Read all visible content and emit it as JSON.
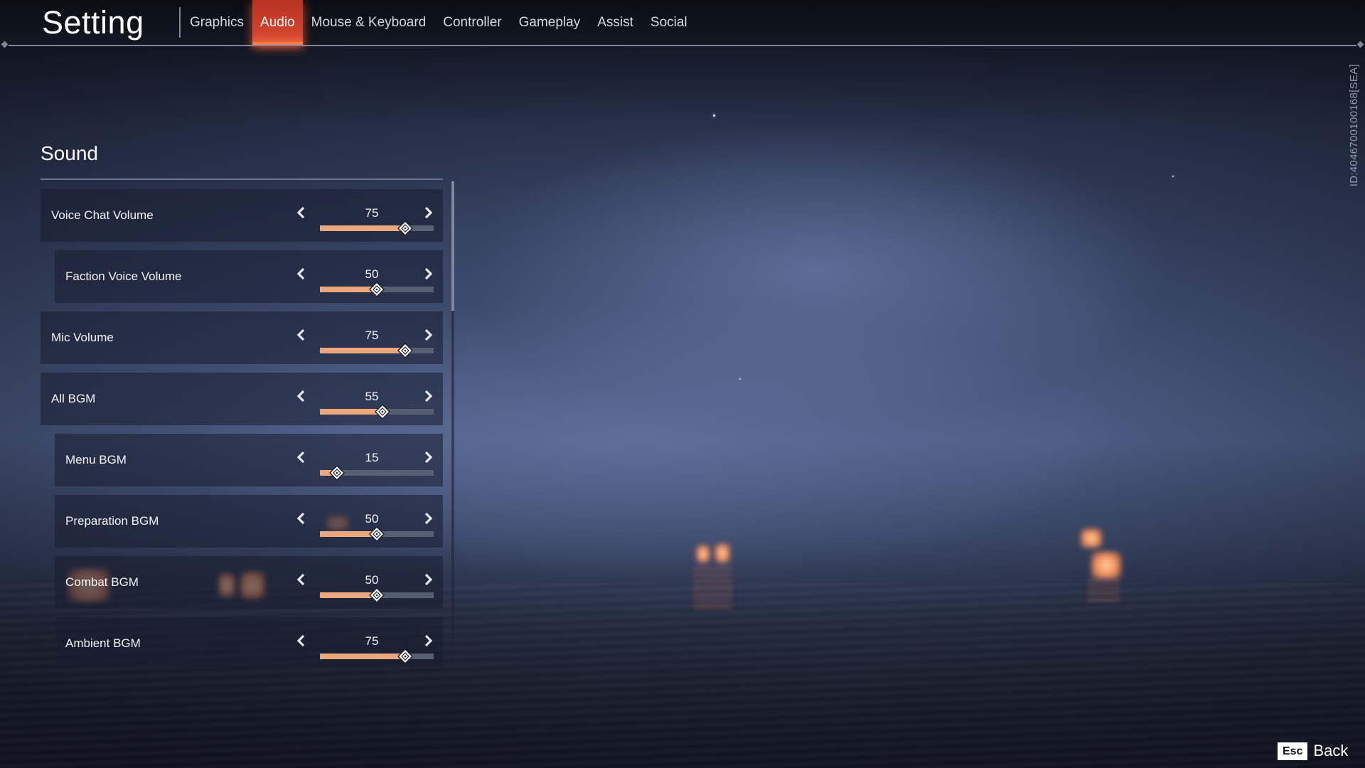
{
  "header": {
    "title": "Setting",
    "tabs": [
      {
        "label": "Graphics",
        "active": false
      },
      {
        "label": "Audio",
        "active": true
      },
      {
        "label": "Mouse & Keyboard",
        "active": false
      },
      {
        "label": "Controller",
        "active": false
      },
      {
        "label": "Gameplay",
        "active": false
      },
      {
        "label": "Assist",
        "active": false
      },
      {
        "label": "Social",
        "active": false
      }
    ],
    "accent_color": "#cf432c"
  },
  "server_id": "ID:4046700100168[SEA]",
  "section": {
    "title": "Sound",
    "slider_range": [
      0,
      100
    ],
    "fill_color": "#eca77b",
    "settings": [
      {
        "label": "Voice Chat Volume",
        "value": 75,
        "indented": false
      },
      {
        "label": "Faction Voice Volume",
        "value": 50,
        "indented": true
      },
      {
        "label": "Mic Volume",
        "value": 75,
        "indented": false
      },
      {
        "label": "All BGM",
        "value": 55,
        "indented": false
      },
      {
        "label": "Menu BGM",
        "value": 15,
        "indented": true
      },
      {
        "label": "Preparation BGM",
        "value": 50,
        "indented": true
      },
      {
        "label": "Combat BGM",
        "value": 50,
        "indented": true
      },
      {
        "label": "Ambient BGM",
        "value": 75,
        "indented": true
      }
    ]
  },
  "icons": {
    "decrease": "chevron-left-icon",
    "increase": "chevron-right-icon",
    "thumb": "diamond-thumb-icon"
  },
  "footer": {
    "key": "Esc",
    "label": "Back"
  }
}
